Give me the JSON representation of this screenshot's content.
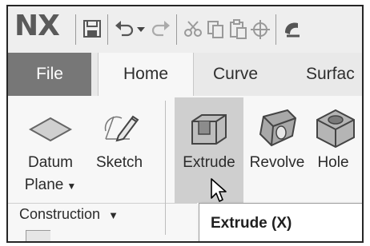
{
  "app": {
    "logo": "NX"
  },
  "quick_access": {
    "icons": [
      "save-icon",
      "undo-icon",
      "undo-dropdown-icon",
      "redo-icon",
      "cut-icon",
      "copy-icon",
      "paste-icon",
      "snap-icon",
      "touch-mode-icon"
    ]
  },
  "tabs": [
    "File",
    "Home",
    "Curve",
    "Surfac"
  ],
  "active_tab": "Home",
  "ribbon": {
    "datum_plane": {
      "line1": "Datum",
      "line2": "Plane"
    },
    "sketch": "Sketch",
    "extrude": "Extrude",
    "revolve": "Revolve",
    "hole": "Hole",
    "group_label": "Construction"
  },
  "tooltip": {
    "title": "Extrude (X)"
  },
  "colors": {
    "file_tab_bg": "#777777",
    "highlight": "#cfcfcf",
    "logo": "#5a5a5a"
  }
}
